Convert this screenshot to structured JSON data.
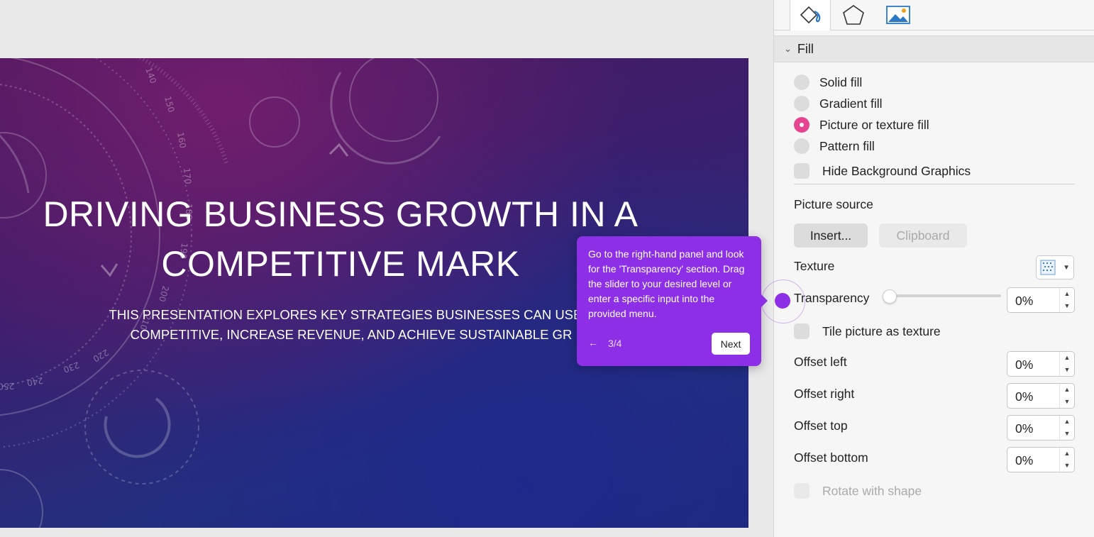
{
  "slide": {
    "title_line1": "DRIVING BUSINESS GROWTH IN A",
    "title_line2": "COMPETITIVE MARK",
    "subtitle_line1": "THIS PRESENTATION EXPLORES KEY STRATEGIES BUSINESSES CAN USE T",
    "subtitle_line2": "COMPETITIVE, INCREASE REVENUE, AND ACHIEVE SUSTAINABLE GR",
    "dial_labels": [
      "140",
      "150",
      "160",
      "170",
      "180",
      "190",
      "200",
      "210",
      "220",
      "230",
      "240",
      "250"
    ]
  },
  "panel": {
    "tabs": [
      {
        "icon": "fill-bucket-icon"
      },
      {
        "icon": "pentagon-icon"
      },
      {
        "icon": "picture-icon"
      }
    ],
    "section_title": "Fill",
    "fill_options": [
      {
        "label": "Solid fill",
        "selected": false
      },
      {
        "label": "Gradient fill",
        "selected": false
      },
      {
        "label": "Picture or texture fill",
        "selected": true
      },
      {
        "label": "Pattern fill",
        "selected": false
      }
    ],
    "hide_background_graphics": "Hide Background Graphics",
    "picture_source_label": "Picture source",
    "insert_button": "Insert...",
    "clipboard_button": "Clipboard",
    "texture_label": "Texture",
    "transparency": {
      "label": "Transparency",
      "value": "0%",
      "slider_fraction": 0
    },
    "tile_label": "Tile picture as texture",
    "offsets": [
      {
        "label": "Offset left",
        "value": "0%"
      },
      {
        "label": "Offset right",
        "value": "0%"
      },
      {
        "label": "Offset top",
        "value": "0%"
      },
      {
        "label": "Offset bottom",
        "value": "0%"
      }
    ],
    "rotate_label": "Rotate with shape"
  },
  "tour": {
    "text": "Go to the right-hand panel and look for the 'Transparency' section. Drag the slider to your desired level or enter a specific input into the provided menu.",
    "back_arrow": "←",
    "step": "3/4",
    "next_label": "Next"
  },
  "colors": {
    "accent_radio": "#e64493",
    "tour_purple": "#8d2fe6"
  }
}
